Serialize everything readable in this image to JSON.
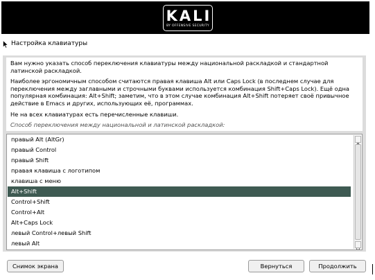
{
  "banner": {
    "logo_text": "KALI",
    "logo_subtitle": "BY OFFENSIVE SECURITY"
  },
  "window": {
    "title": "Настройка клавиатуры"
  },
  "info": {
    "paragraph1": "Вам нужно указать способ переключения клавиатуры между национальной раскладкой и стандартной латинской раскладкой.",
    "paragraph2": "Наиболее эргономичным способом считаются правая клавиша Alt или Caps Lock (в последнем случае для переключения между заглавными и строчными буквами используется комбинация Shift+Caps Lock). Ещё одна популярная комбинация: Alt+Shift; заметим, что в этом случае комбинация Alt+Shift потеряет своё привычное действие в Emacs и других, использующих её, программах.",
    "paragraph3": "Не на всех клавиатурах есть перечисленные клавиши.",
    "prompt": "Способ переключения между национальной и латинской раскладкой:"
  },
  "switch_methods": {
    "selected": "Alt+Shift",
    "options": [
      "правый Alt (AltGr)",
      "правый Control",
      "правый Shift",
      "правая клавиша с логотипом",
      "клавиша с меню",
      "Alt+Shift",
      "Control+Shift",
      "Control+Alt",
      "Alt+Caps Lock",
      "левый Control+левый Shift",
      "левый Alt"
    ]
  },
  "buttons": {
    "screenshot": "Снимок экрана",
    "back": "Вернуться",
    "continue": "Продолжить"
  },
  "colors": {
    "selection_background": "#3e5a52",
    "banner_background": "#000000",
    "panel_background": "#dcdcdc"
  },
  "icons": {
    "pointer": "mouse-pointer-icon",
    "scroll_up": "scroll-up-arrow-icon",
    "scroll_down": "scroll-down-arrow-icon"
  }
}
